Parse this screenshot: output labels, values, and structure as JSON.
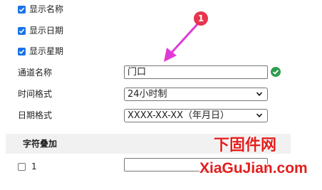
{
  "display_options": [
    {
      "label": "显示名称",
      "checked": true
    },
    {
      "label": "显示日期",
      "checked": true
    },
    {
      "label": "显示星期",
      "checked": true
    }
  ],
  "channel_name": {
    "label": "通道名称",
    "value": "门口",
    "status_icon": "check-circle-icon",
    "status_color": "#2e9e4f"
  },
  "time_format": {
    "label": "时间格式",
    "selected": "24小时制"
  },
  "date_format": {
    "label": "日期格式",
    "selected": "XXXX-XX-XX（年月日）"
  },
  "overlay_section": {
    "title": "字符叠加"
  },
  "overlay_items": [
    {
      "label": "1",
      "checked": false,
      "value": ""
    }
  ],
  "annotation": {
    "badge_number": "1",
    "color": "#e8344e"
  },
  "watermark": {
    "line1": "下固件网",
    "line2": "XiaGuJian.com",
    "color": "#e31e1e"
  }
}
